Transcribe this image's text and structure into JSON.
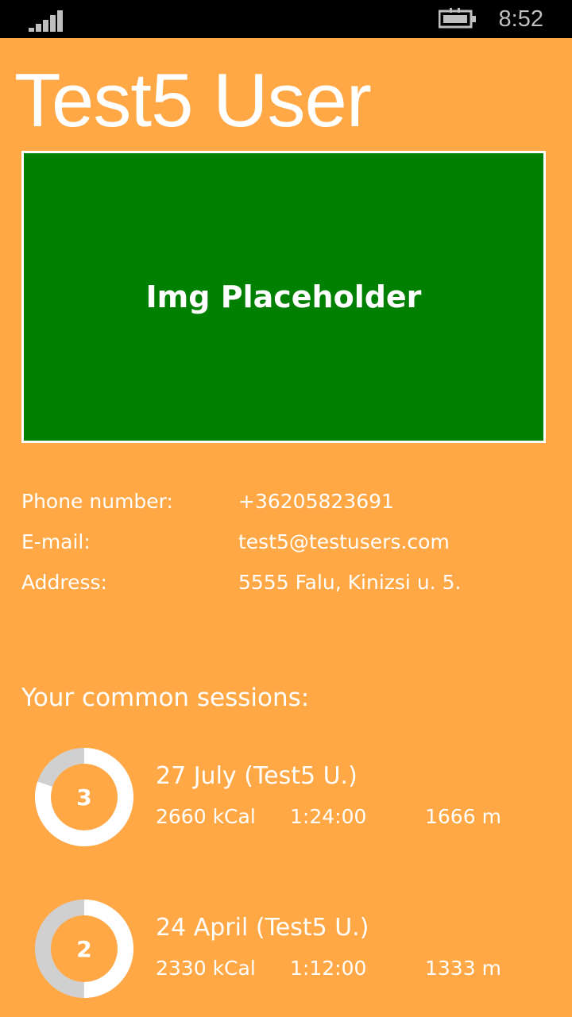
{
  "status_bar": {
    "time": "8:52",
    "signal_icon": "signal-strength-icon",
    "battery_icon": "battery-charging-icon"
  },
  "colors": {
    "background": "#FFA845",
    "placeholder": "#008000",
    "ring_track": "#D0D0D0",
    "ring_fill": "#FFFFFF"
  },
  "profile": {
    "name": "Test5 User",
    "image_placeholder": "Img Placeholder"
  },
  "contact": {
    "phone_label": "Phone number:",
    "phone_value": "+36205823691",
    "email_label": "E-mail:",
    "email_value": "test5@testusers.com",
    "address_label": "Address:",
    "address_value": "5555 Falu, Kinizsi u. 5."
  },
  "sessions": {
    "heading": "Your common sessions:",
    "items": [
      {
        "count": "3",
        "progress": 0.8,
        "title": "27 July (Test5 U.)",
        "kcal": "2660 kCal",
        "time": "1:24:00",
        "distance": "1666 m"
      },
      {
        "count": "2",
        "progress": 0.5,
        "title": "24 April (Test5 U.)",
        "kcal": "2330 kCal",
        "time": "1:12:00",
        "distance": "1333 m"
      }
    ]
  }
}
